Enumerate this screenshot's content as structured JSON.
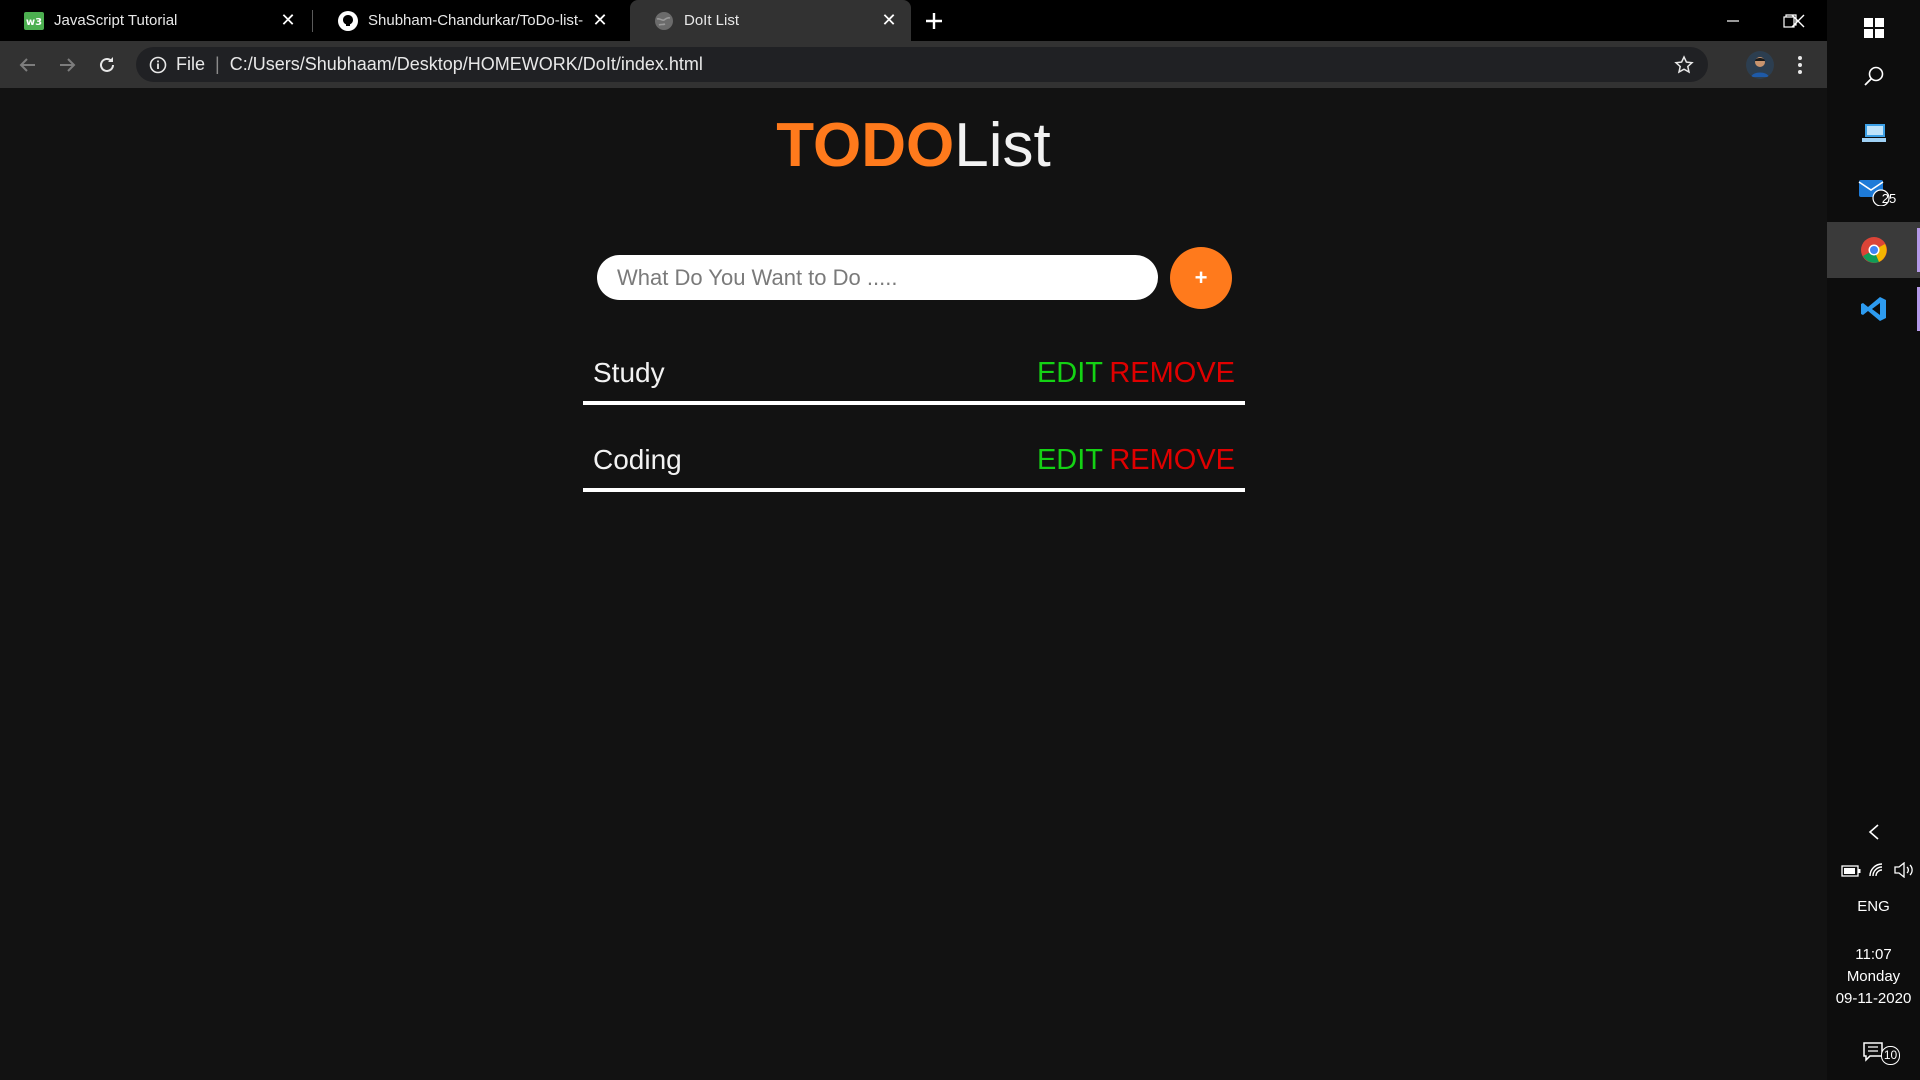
{
  "tabs": [
    {
      "label": "JavaScript Tutorial",
      "icon": "w3schools-icon",
      "active": false
    },
    {
      "label": "Shubham-Chandurkar/ToDo-list-",
      "icon": "github-icon",
      "active": false
    },
    {
      "label": "DoIt List",
      "icon": "globe-icon",
      "active": true
    }
  ],
  "toolbar": {
    "scheme": "File",
    "url": "C:/Users/Shubhaam/Desktop/HOMEWORK/DoIt/index.html"
  },
  "app": {
    "title_accent": "TODO",
    "title_rest": "List",
    "input_placeholder": "What Do You Want to Do .....",
    "add_label": "+",
    "accent_color": "#ff7a1c",
    "todos": [
      {
        "text": "Study",
        "edit": "EDIT",
        "remove": "REMOVE"
      },
      {
        "text": "Coding",
        "edit": "EDIT",
        "remove": "REMOVE"
      }
    ]
  },
  "taskbar": {
    "mail_badge": "25",
    "language": "ENG",
    "time": "11:07",
    "day": "Monday",
    "date": "09-11-2020",
    "notification_count": "10"
  }
}
